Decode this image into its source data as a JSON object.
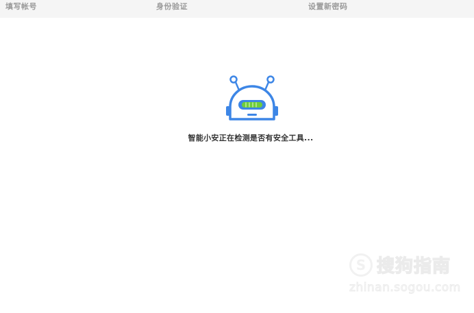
{
  "steps": [
    {
      "label": "填写帐号"
    },
    {
      "label": "身份验证"
    },
    {
      "label": "设置新密码"
    }
  ],
  "status": {
    "message": "智能小安正在检测是否有安全工具..."
  },
  "watermark": {
    "logo_letter": "S",
    "title": "搜狗指南",
    "url": "zhinan.sogou.com"
  },
  "colors": {
    "robot_blue": "#3d86e6",
    "robot_green": "#6fce3a",
    "steps_bg": "#f5f5f5",
    "step_text": "#9a9a9a"
  }
}
